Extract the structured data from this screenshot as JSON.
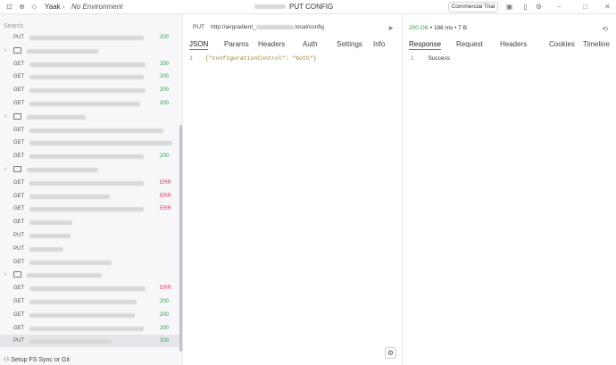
{
  "titlebar": {
    "app": "Yaak",
    "environment": "No Environment",
    "request_title": "PUT CONFIG",
    "trial": "Commercial Trial"
  },
  "sidebar": {
    "search_placeholder": "Search",
    "rows": [
      {
        "type": "request",
        "method": "PUT",
        "status": "200"
      },
      {
        "type": "folder"
      },
      {
        "type": "request",
        "method": "GET",
        "status": "200"
      },
      {
        "type": "request",
        "method": "GET",
        "status": "200"
      },
      {
        "type": "request",
        "method": "GET",
        "status": "200"
      },
      {
        "type": "request",
        "method": "GET",
        "status": "200"
      },
      {
        "type": "folder"
      },
      {
        "type": "request",
        "method": "GET",
        "status": ""
      },
      {
        "type": "request",
        "method": "GET",
        "status": ""
      },
      {
        "type": "request",
        "method": "GET",
        "status": "200"
      },
      {
        "type": "folder"
      },
      {
        "type": "request",
        "method": "GET",
        "status": "ERR"
      },
      {
        "type": "request",
        "method": "GET",
        "status": "ERR"
      },
      {
        "type": "request",
        "method": "GET",
        "status": "ERR"
      },
      {
        "type": "request",
        "method": "GET",
        "status": ""
      },
      {
        "type": "request",
        "method": "PUT",
        "status": ""
      },
      {
        "type": "request",
        "method": "PUT",
        "status": ""
      },
      {
        "type": "request",
        "method": "GET",
        "status": ""
      },
      {
        "type": "folder"
      },
      {
        "type": "request",
        "method": "GET",
        "status": "ERR"
      },
      {
        "type": "request",
        "method": "GET",
        "status": "200"
      },
      {
        "type": "request",
        "method": "GET",
        "status": "200"
      },
      {
        "type": "request",
        "method": "GET",
        "status": "200"
      },
      {
        "type": "request",
        "method": "PUT",
        "status": "200"
      }
    ],
    "sync_label": "Setup FS Sync or Git"
  },
  "request": {
    "method": "PUT",
    "url_prefix": "http://airgradient_",
    "url_suffix": ".local/config",
    "tabs": [
      "JSON",
      "Params",
      "Headers",
      "Auth",
      "Settings",
      "Info"
    ],
    "body_line": "1",
    "body": "{\"configurationControl\": \"both\"}"
  },
  "response": {
    "status": "200 OK",
    "time": "196 ms",
    "size": "7 B",
    "tabs": [
      "Response",
      "Request",
      "Headers",
      "Cookies",
      "Timeline"
    ],
    "line": "1",
    "body": "Success"
  }
}
